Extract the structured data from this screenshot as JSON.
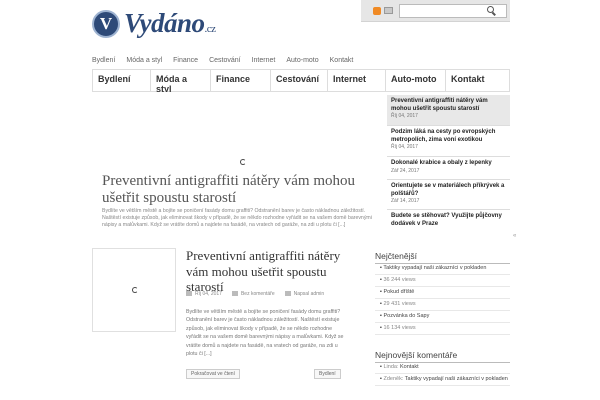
{
  "logo": {
    "badge": "V",
    "name": "Vydáno",
    "tld": ".cz"
  },
  "search": {
    "placeholder": ""
  },
  "topnav": [
    "Bydlení",
    "Móda a styl",
    "Finance",
    "Cestování",
    "Internet",
    "Auto-moto",
    "Kontakt"
  ],
  "mainnav": [
    "Bydlení",
    "Móda a styl",
    "Finance",
    "Cestování",
    "Internet",
    "Auto-moto",
    "Kontakt"
  ],
  "featured": {
    "title": "Preventivní antigraffiti nátěry vám mohou ušetřit spoustu starostí",
    "excerpt": "Bydlíte ve větším městě a bojíte se poničení fasády domu graffiti? Odstranění barev je často nákladnou záležitostí. Naštěstí existuje způsob, jak eliminovat škody v případě, že se někdo rozhodne vyřádit se na vašem domě barevnými nápisy a malůvkami. Když se vrátíte domů a najdete na fasádě, na vratech od garáže, na zdi u plotu či [...]"
  },
  "slider": [
    {
      "title": "Preventivní antigraffiti nátěry vám mohou ušetřit spoustu starostí",
      "date": "Říj 04, 2017"
    },
    {
      "title": "Podzim láká na cesty po evropských metropolích, zima voní exotikou",
      "date": "Říj 04, 2017"
    },
    {
      "title": "Dokonalé krabice a obaly z lepenky",
      "date": "Zář 24, 2017"
    },
    {
      "title": "Orientujete se v materiálech příkrývek a polštářů?",
      "date": "Zář 14, 2017"
    },
    {
      "title": "Budete se stěhovat? Využijte půjčovny dodávek v Praze",
      "date": ""
    }
  ],
  "slider_prev": "«",
  "post": {
    "title": "Preventivní antigraffiti nátěry vám mohou ušetřit spoustu starostí",
    "date": "Říj 04, 2017",
    "comments": "Bez komentáře",
    "author": "Napsal admin",
    "excerpt": "Bydlíte ve větším městě a bojíte se poničení fasády domu graffiti? Odstranění barev je často nákladnou záležitostí. Naštěstí existuje způsob, jak eliminovat škody v případě, že se někdo rozhodne vyřádit se na vašem domě barevnými nápisy a malůvkami. Když se vrátíte domů a najdete na fasádě, na vratech od garáže, na zdi u plotu či [...]",
    "read_more": "Pokračovat ve čtení",
    "category": "Bydlení"
  },
  "sidebar": {
    "popular_title": "Nejčtenější",
    "popular": [
      {
        "title": "Taktiky vypadají naši zákazníci v pokladen",
        "sub": ""
      },
      {
        "title": "",
        "sub": "36 244 views"
      },
      {
        "title": "Pokud dříště",
        "sub": ""
      },
      {
        "title": "",
        "sub": "29 431 views"
      },
      {
        "title": "Pozvánka do Sapy",
        "sub": ""
      },
      {
        "title": "",
        "sub": "16 134 views"
      }
    ],
    "comments_title": "Nejnovější komentáře",
    "comments": [
      {
        "who": "Linda:",
        "what": "Kontakt"
      },
      {
        "who": "Zdeněk:",
        "what": "Taktiky vypadají naši zákazníci v pokladen"
      }
    ]
  }
}
